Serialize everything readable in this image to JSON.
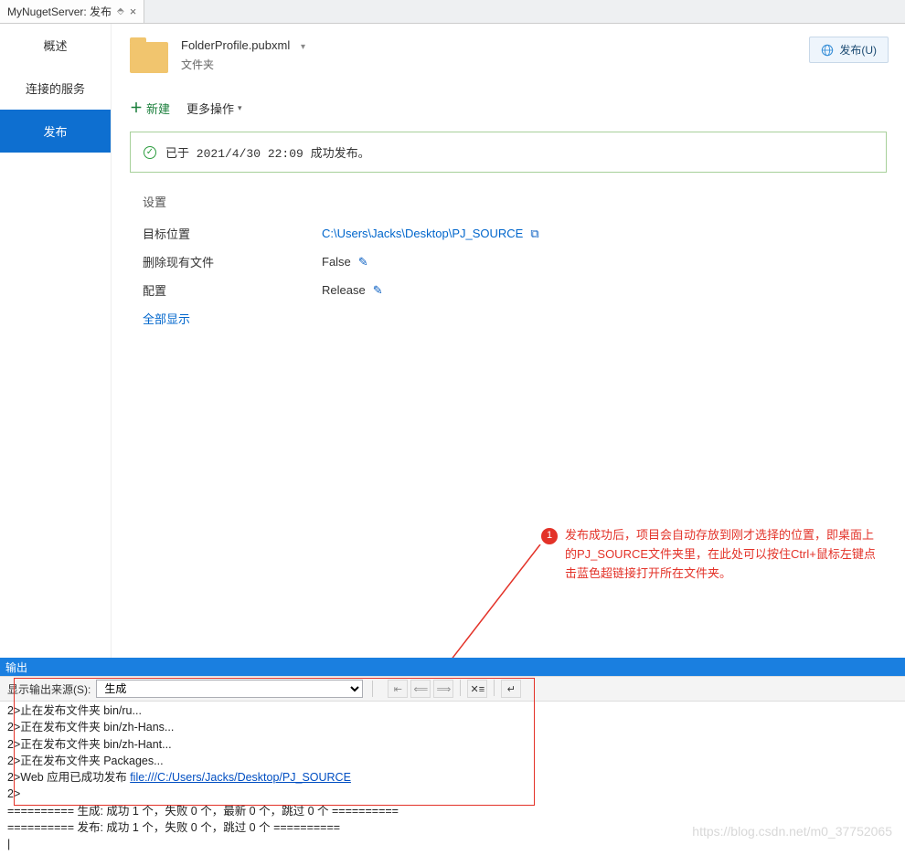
{
  "tab": {
    "title": "MyNugetServer: 发布"
  },
  "sidebar": {
    "items": [
      {
        "label": "概述"
      },
      {
        "label": "连接的服务"
      },
      {
        "label": "发布"
      }
    ]
  },
  "profile": {
    "file": "FolderProfile.pubxml",
    "type": "文件夹"
  },
  "actions": {
    "publish": "发布(U)",
    "new": "新建",
    "more": "更多操作"
  },
  "status": {
    "text": "已于 2021/4/30 22:09 成功发布。"
  },
  "settings": {
    "title": "设置",
    "rows": [
      {
        "label": "目标位置",
        "value": "C:\\Users\\Jacks\\Desktop\\PJ_SOURCE",
        "link": true,
        "copy": true
      },
      {
        "label": "删除现有文件",
        "value": "False",
        "edit": true
      },
      {
        "label": "配置",
        "value": "Release",
        "edit": true
      }
    ],
    "show_all": "全部显示"
  },
  "annotation": {
    "num": "1",
    "text": "发布成功后，项目会自动存放到刚才选择的位置，即桌面上的PJ_SOURCE文件夹里，在此处可以按住Ctrl+鼠标左键点击蓝色超链接打开所在文件夹。"
  },
  "output": {
    "title": "输出",
    "source_label": "显示输出来源(S):",
    "source_value": "生成",
    "lines_pre": "2>止在发布文件夹 bin/ru...\n2>正在发布文件夹 bin/zh-Hans...\n2>正在发布文件夹 bin/zh-Hant...\n2>正在发布文件夹 Packages...\n2>Web 应用已成功发布 ",
    "link": "file:///C:/Users/Jacks/Desktop/PJ_SOURCE",
    "lines_post": "\n2>\n========== 生成: 成功 1 个，失败 0 个，最新 0 个，跳过 0 个 ==========\n========== 发布: 成功 1 个，失败 0 个，跳过 0 个 ==========\n|"
  },
  "watermark": "https://blog.csdn.net/m0_37752065"
}
